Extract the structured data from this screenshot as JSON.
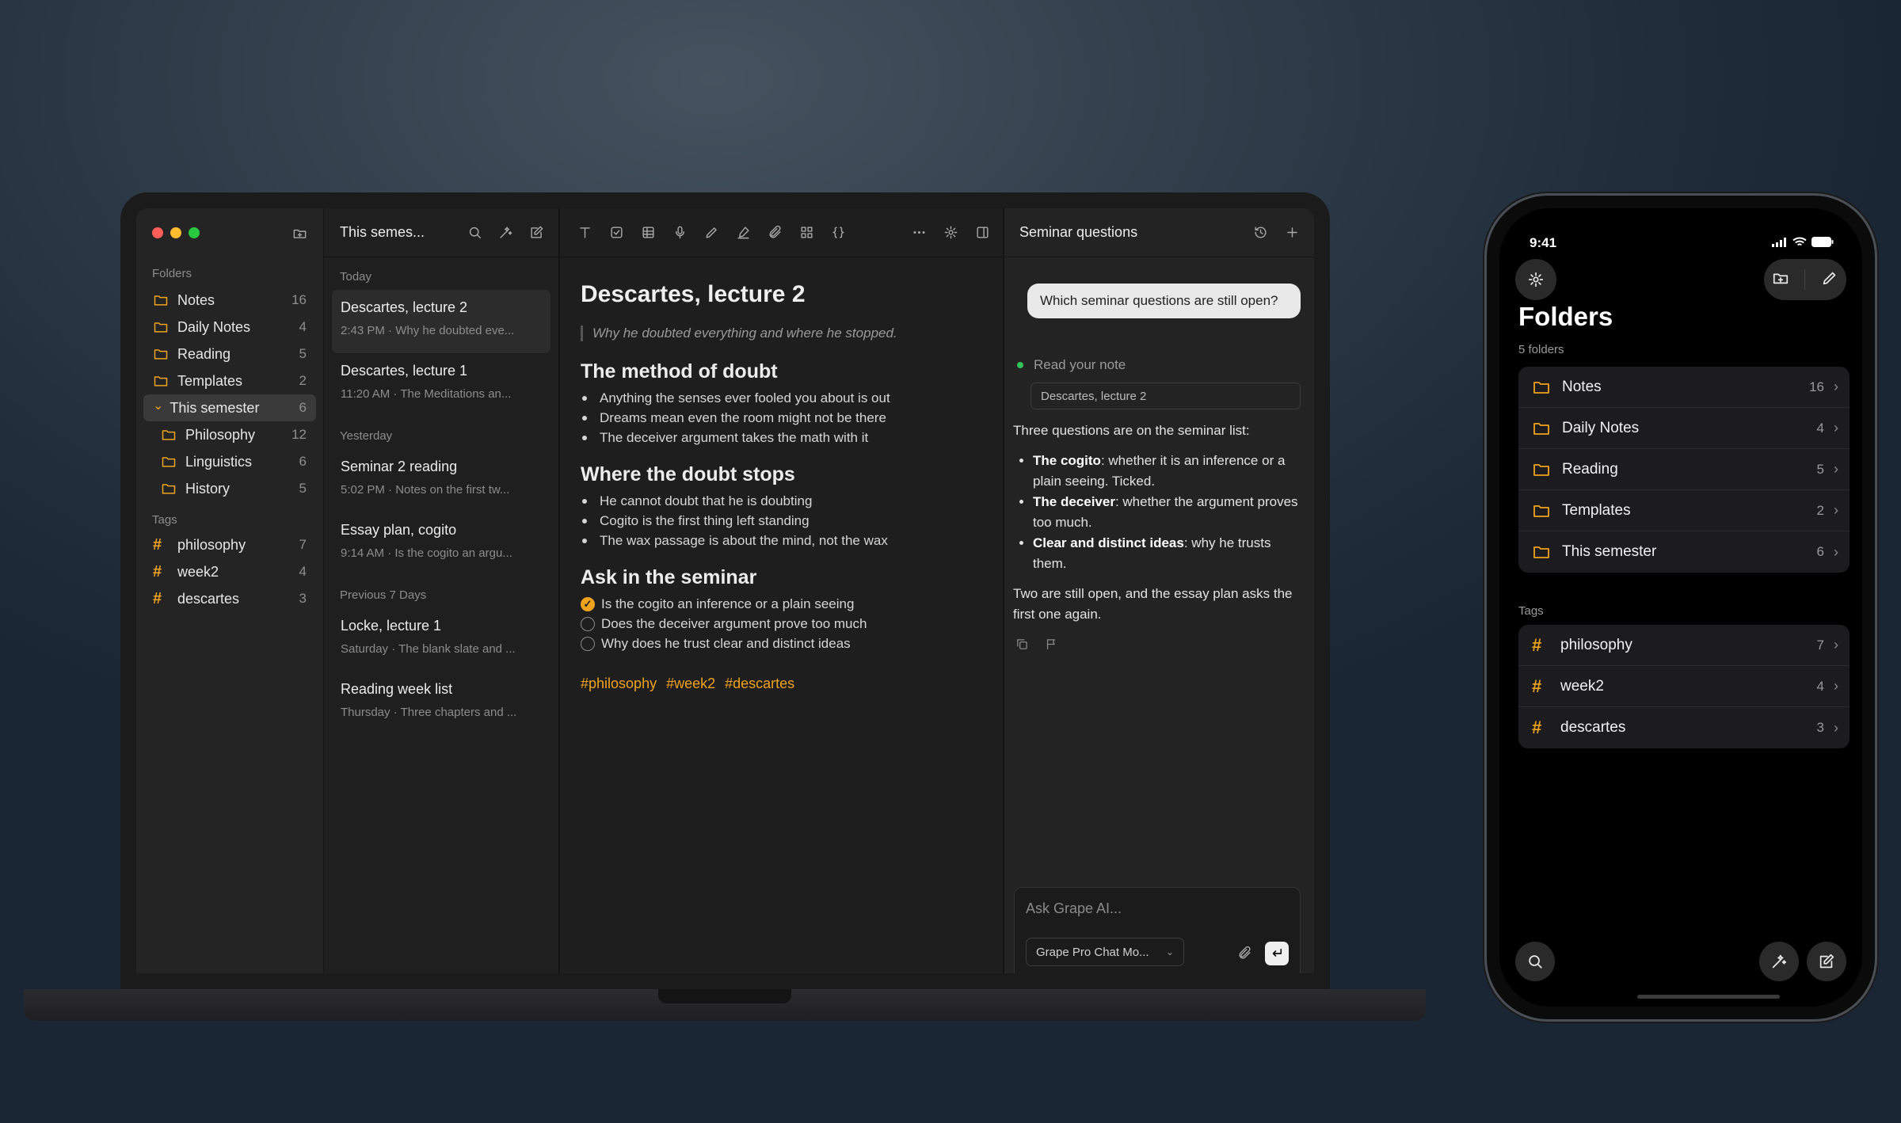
{
  "laptop": {
    "sidebar": {
      "folders_label": "Folders",
      "folders": [
        {
          "name": "Notes",
          "count": "16"
        },
        {
          "name": "Daily Notes",
          "count": "4"
        },
        {
          "name": "Reading",
          "count": "5"
        },
        {
          "name": "Templates",
          "count": "2"
        },
        {
          "name": "This semester",
          "count": "6"
        },
        {
          "name": "Philosophy",
          "count": "12"
        },
        {
          "name": "Linguistics",
          "count": "6"
        },
        {
          "name": "History",
          "count": "5"
        }
      ],
      "tags_label": "Tags",
      "tags": [
        {
          "name": "philosophy",
          "count": "7"
        },
        {
          "name": "week2",
          "count": "4"
        },
        {
          "name": "descartes",
          "count": "3"
        }
      ]
    },
    "notelist": {
      "title": "This semes...",
      "groups": [
        {
          "label": "Today",
          "notes": [
            {
              "title": "Descartes, lecture 2",
              "meta": "2:43 PM · Why he doubted eve..."
            },
            {
              "title": "Descartes, lecture 1",
              "meta": "11:20 AM · The Meditations an..."
            }
          ]
        },
        {
          "label": "Yesterday",
          "notes": [
            {
              "title": "Seminar 2 reading",
              "meta": "5:02 PM · Notes on the first tw..."
            },
            {
              "title": "Essay plan, cogito",
              "meta": "9:14 AM · Is the cogito an argu..."
            }
          ]
        },
        {
          "label": "Previous 7 Days",
          "notes": [
            {
              "title": "Locke, lecture 1",
              "meta": "Saturday · The blank slate and ..."
            },
            {
              "title": "Reading week list",
              "meta": "Thursday · Three chapters and ..."
            }
          ]
        }
      ]
    },
    "editor": {
      "title": "Descartes, lecture 2",
      "quote": "Why he doubted everything and where he stopped.",
      "h_method": "The method of doubt",
      "method_items": [
        "Anything the senses ever fooled you about is out",
        "Dreams mean even the room might not be there",
        "The deceiver argument takes the math with it"
      ],
      "h_stops": "Where the doubt stops",
      "stops_items": [
        "He cannot doubt that he is doubting",
        "Cogito is the first thing left standing",
        "The wax passage is about the mind, not the wax"
      ],
      "h_ask": "Ask in the seminar",
      "tasks": [
        {
          "text": "Is the cogito an inference or a plain seeing",
          "done": true
        },
        {
          "text": "Does the deceiver argument prove too much",
          "done": false
        },
        {
          "text": "Why does he trust clear and distinct ideas",
          "done": false
        }
      ],
      "tags": [
        "#philosophy",
        "#week2",
        "#descartes"
      ],
      "done_mark": "✓"
    },
    "chat": {
      "title": "Seminar questions",
      "question": "Which seminar questions are still open?",
      "status": "Read your note",
      "source": "Descartes, lecture 2",
      "answer_intro": "Three questions are on the seminar list:",
      "points": [
        {
          "bold": "The cogito",
          "rest": ": whether it is an inference or a plain seeing. Ticked."
        },
        {
          "bold": "The deceiver",
          "rest": ": whether the argument proves too much."
        },
        {
          "bold": "Clear and distinct ideas",
          "rest": ": why he trusts them."
        }
      ],
      "answer_outro": "Two are still open, and the essay plan asks the first one again.",
      "composer_placeholder": "Ask Grape AI...",
      "model": "Grape Pro Chat Mo..."
    }
  },
  "phone": {
    "time": "9:41",
    "title": "Folders",
    "subtitle": "5 folders",
    "folders": [
      {
        "name": "Notes",
        "count": "16"
      },
      {
        "name": "Daily Notes",
        "count": "4"
      },
      {
        "name": "Reading",
        "count": "5"
      },
      {
        "name": "Templates",
        "count": "2"
      },
      {
        "name": "This semester",
        "count": "6"
      }
    ],
    "tags_label": "Tags",
    "tags": [
      {
        "name": "philosophy",
        "count": "7"
      },
      {
        "name": "week2",
        "count": "4"
      },
      {
        "name": "descartes",
        "count": "3"
      }
    ]
  },
  "colors": {
    "accent": "#f0a31c",
    "traffic": [
      "#ff5f57",
      "#febc2e",
      "#28c840"
    ],
    "status_dot": "#2fc25b"
  },
  "icons": [
    "new-folder-icon",
    "search-icon",
    "magic-icon",
    "compose-icon",
    "text-icon",
    "checklist-icon",
    "table-icon",
    "mic-icon",
    "pen-icon",
    "marker-icon",
    "attach-icon",
    "grid-icon",
    "code-icon",
    "more-icon",
    "gear-icon",
    "sidebar-icon",
    "history-icon",
    "plus-icon",
    "copy-icon",
    "flag-icon",
    "send-icon",
    "chevron-down-icon",
    "folder-icon",
    "hash-icon",
    "chevron-right-icon"
  ]
}
